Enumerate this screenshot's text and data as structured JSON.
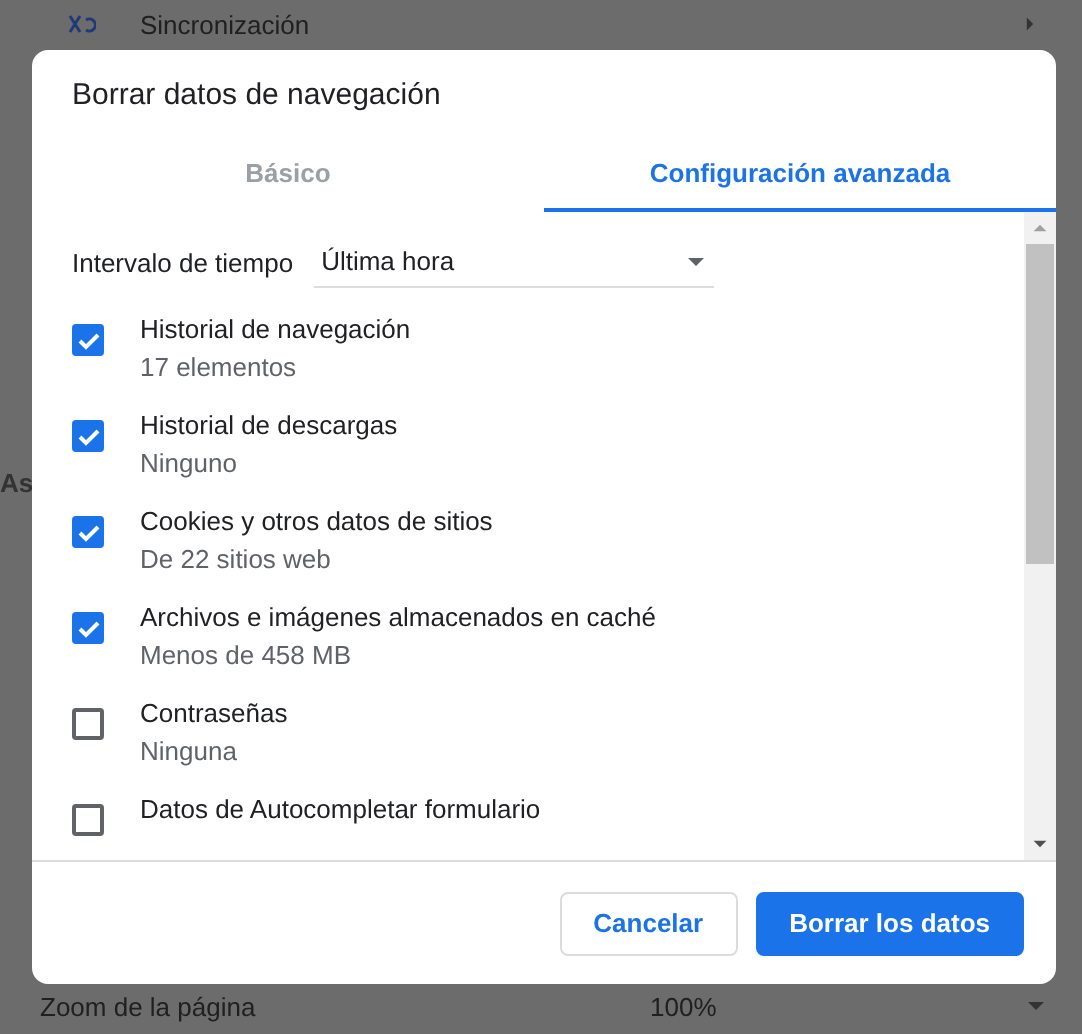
{
  "background": {
    "sync_label": "Sincronización",
    "cut_label": "As",
    "zoom_label": "Zoom de la página",
    "zoom_value": "100%"
  },
  "dialog": {
    "title": "Borrar datos de navegación",
    "tabs": [
      {
        "label": "Básico",
        "selected": false
      },
      {
        "label": "Configuración avanzada",
        "selected": true
      }
    ],
    "time_range": {
      "label": "Intervalo de tiempo",
      "value": "Última hora"
    },
    "items": [
      {
        "title": "Historial de navegación",
        "detail": "17 elementos",
        "checked": true
      },
      {
        "title": "Historial de descargas",
        "detail": "Ninguno",
        "checked": true
      },
      {
        "title": "Cookies y otros datos de sitios",
        "detail": "De 22 sitios web",
        "checked": true
      },
      {
        "title": "Archivos e imágenes almacenados en caché",
        "detail": "Menos de 458 MB",
        "checked": true
      },
      {
        "title": "Contraseñas",
        "detail": "Ninguna",
        "checked": false
      },
      {
        "title": "Datos de Autocompletar formulario",
        "checked": false
      }
    ],
    "buttons": [
      {
        "label": "Cancelar",
        "kind": "secondary"
      },
      {
        "label": "Borrar los datos",
        "kind": "primary"
      }
    ]
  }
}
